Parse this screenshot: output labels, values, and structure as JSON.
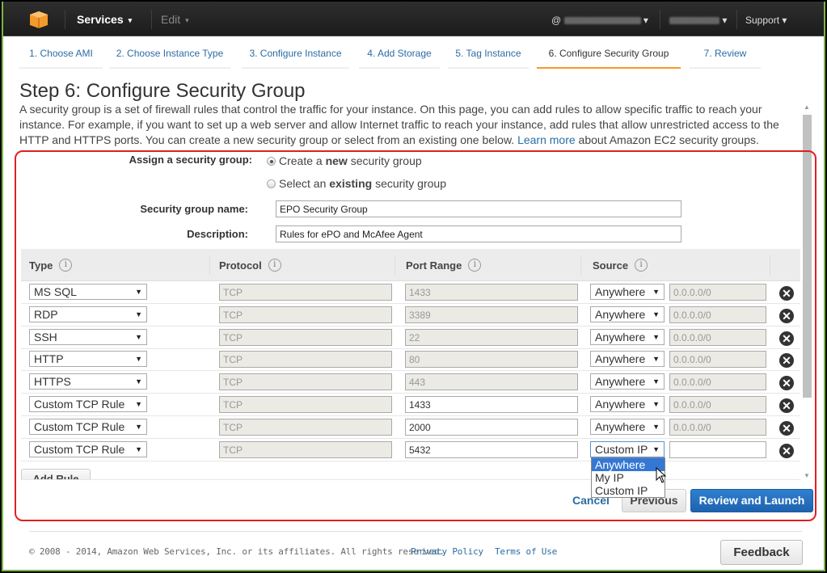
{
  "topnav": {
    "logo": "aws-cube-logo",
    "services_label": "Services",
    "edit_label": "Edit",
    "account_prefix": "@",
    "account_id": "[redacted]",
    "region": "[redacted]",
    "support_label": "Support",
    "caret": "▾"
  },
  "steps": [
    {
      "label": "1. Choose AMI",
      "active": false
    },
    {
      "label": "2. Choose Instance Type",
      "active": false
    },
    {
      "label": "3. Configure Instance",
      "active": false
    },
    {
      "label": "4. Add Storage",
      "active": false
    },
    {
      "label": "5. Tag Instance",
      "active": false
    },
    {
      "label": "6. Configure Security Group",
      "active": true
    },
    {
      "label": "7. Review",
      "active": false
    }
  ],
  "page": {
    "title": "Step 6: Configure Security Group",
    "intro_text": "A security group is a set of firewall rules that control the traffic for your instance. On this page, you can add rules to allow specific traffic to reach your instance. For example, if you want to set up a web server and allow Internet traffic to reach your instance, add rules that allow unrestricted access to the HTTP and HTTPS ports. You can create a new security group or select from an existing one below.",
    "learn_more_link": "Learn more",
    "intro_suffix": "about Amazon EC2 security groups."
  },
  "form": {
    "assign_label": "Assign a security group:",
    "option_new_prefix": "Create a ",
    "option_new_bold": "new",
    "option_new_suffix": " security group",
    "option_existing_prefix": "Select an ",
    "option_existing_bold": "existing",
    "option_existing_suffix": " security group",
    "selected_option": "new",
    "name_label": "Security group name:",
    "name_value": "EPO Security Group",
    "description_label": "Description:",
    "description_value": "Rules for ePO and McAfee Agent"
  },
  "table": {
    "headers": [
      "Type",
      "Protocol",
      "Port Range",
      "Source"
    ],
    "info_glyph": "i",
    "remove_glyph": "✕",
    "select_arrow": "▼",
    "rules": [
      {
        "type": "MS SQL",
        "protocol": "TCP",
        "port": "1433",
        "port_editable": false,
        "source": "Anywhere",
        "cidr": "0.0.0.0/0",
        "cidr_editable": false
      },
      {
        "type": "RDP",
        "protocol": "TCP",
        "port": "3389",
        "port_editable": false,
        "source": "Anywhere",
        "cidr": "0.0.0.0/0",
        "cidr_editable": false
      },
      {
        "type": "SSH",
        "protocol": "TCP",
        "port": "22",
        "port_editable": false,
        "source": "Anywhere",
        "cidr": "0.0.0.0/0",
        "cidr_editable": false
      },
      {
        "type": "HTTP",
        "protocol": "TCP",
        "port": "80",
        "port_editable": false,
        "source": "Anywhere",
        "cidr": "0.0.0.0/0",
        "cidr_editable": false
      },
      {
        "type": "HTTPS",
        "protocol": "TCP",
        "port": "443",
        "port_editable": false,
        "source": "Anywhere",
        "cidr": "0.0.0.0/0",
        "cidr_editable": false
      },
      {
        "type": "Custom TCP Rule",
        "protocol": "TCP",
        "port": "1433",
        "port_editable": true,
        "source": "Anywhere",
        "cidr": "0.0.0.0/0",
        "cidr_editable": false
      },
      {
        "type": "Custom TCP Rule",
        "protocol": "TCP",
        "port": "2000",
        "port_editable": true,
        "source": "Anywhere",
        "cidr": "0.0.0.0/0",
        "cidr_editable": false
      },
      {
        "type": "Custom TCP Rule",
        "protocol": "TCP",
        "port": "5432",
        "port_editable": true,
        "source": "Custom IP",
        "cidr": "",
        "cidr_editable": true
      }
    ],
    "add_rule_label": "Add Rule"
  },
  "source_dropdown": {
    "options": [
      "Anywhere",
      "My IP",
      "Custom IP"
    ],
    "highlighted": "Anywhere"
  },
  "actions": {
    "cancel_label": "Cancel",
    "previous_label": "Previous",
    "launch_label": "Review and Launch"
  },
  "footer": {
    "copyright": "© 2008 - 2014, Amazon Web Services, Inc. or its affiliates. All rights reserved.",
    "privacy_label": "Privacy Policy",
    "terms_label": "Terms of Use",
    "feedback_label": "Feedback"
  },
  "colors": {
    "nav_bg": "#232323",
    "link": "#2b6ca3",
    "active_step_underline": "#f49a2b",
    "primary_button": "#2673c2",
    "highlight_box": "#e02020",
    "dropdown_highlight": "#3478d4",
    "window_border": "#7ab648"
  }
}
